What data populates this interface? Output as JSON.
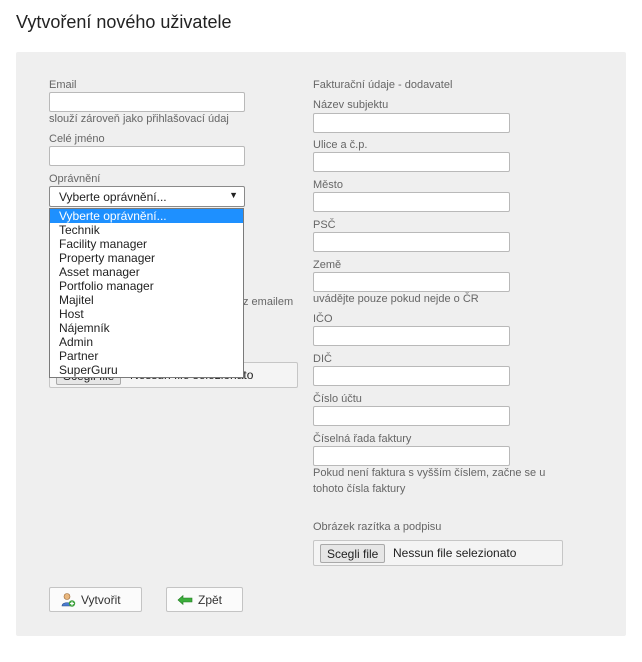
{
  "page": {
    "title": "Vytvoření nového uživatele"
  },
  "left": {
    "email_label": "Email",
    "email_value": "",
    "email_hint": "slouží zároveň jako přihlašovací údaj",
    "fullname_label": "Celé jméno",
    "fullname_value": "",
    "perm_label": "Oprávnění",
    "perm_selected": "Vyberte oprávnění...",
    "perm_options": [
      "Vyberte oprávnění...",
      "Technik",
      "Facility manager",
      "Property manager",
      "Asset manager",
      "Portfolio manager",
      "Majitel",
      "Host",
      "Nájemník",
      "Admin",
      "Partner",
      "SuperGuru"
    ],
    "partial_text": "z emailem",
    "file_button": "Scegli file",
    "file_status": "Nessun file selezionato"
  },
  "right": {
    "section_title": "Fakturační údaje - dodavatel",
    "subject_label": "Název subjektu",
    "street_label": "Ulice a č.p.",
    "city_label": "Město",
    "zip_label": "PSČ",
    "country_label": "Země",
    "country_hint": "uvádějte pouze pokud nejde o ČR",
    "ico_label": "IČO",
    "dic_label": "DIČ",
    "account_label": "Číslo účtu",
    "invoice_series_label": "Číselná řada faktury",
    "invoice_hint": "Pokud není faktura s vyšším číslem, začne se u tohoto čísla faktury",
    "stamp_label": "Obrázek razítka a podpisu",
    "file_button": "Scegli file",
    "file_status": "Nessun file selezionato"
  },
  "actions": {
    "create_label": "Vytvořit",
    "back_label": "Zpět"
  },
  "colors": {
    "panel_bg": "#efefef",
    "selected_option_bg": "#1e90ff"
  },
  "icons": {
    "create": "add-user-icon",
    "back": "arrow-left-icon"
  }
}
